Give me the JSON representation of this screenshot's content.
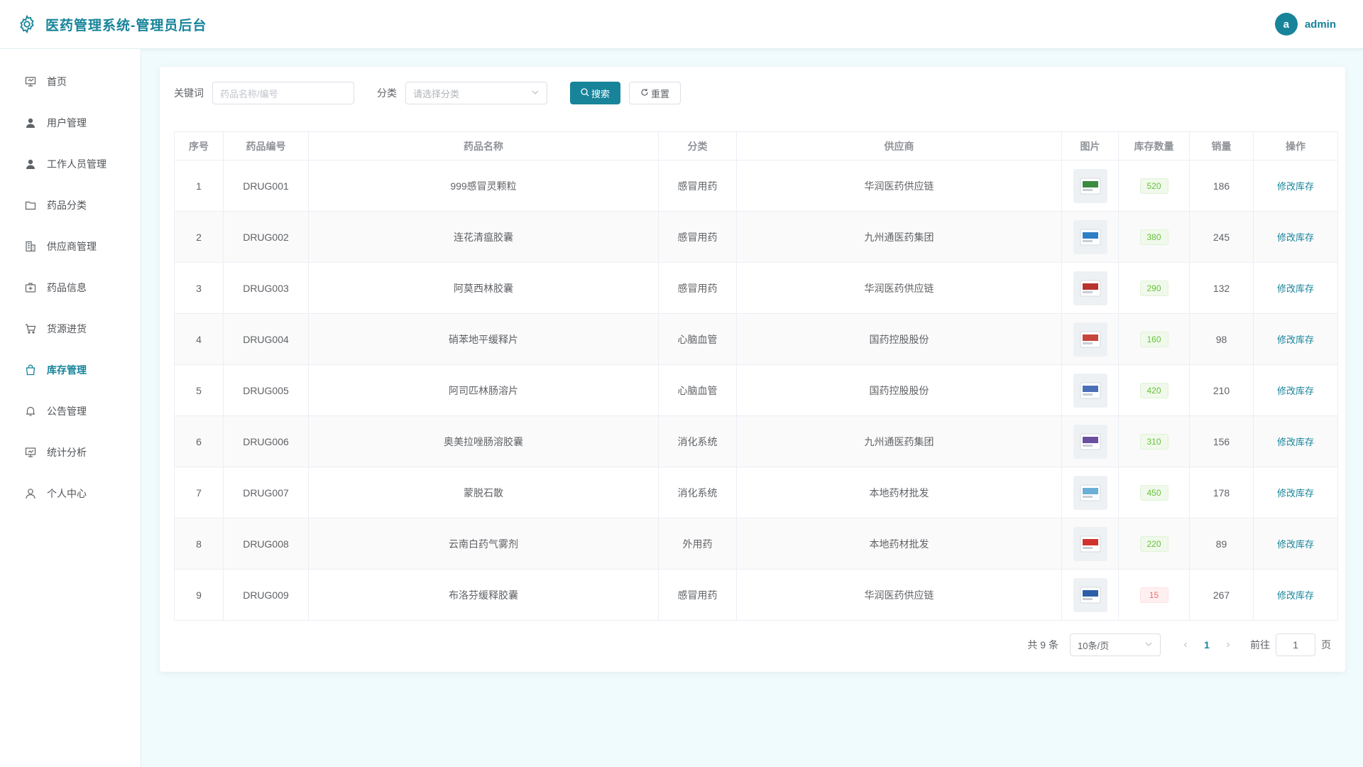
{
  "header": {
    "title": "医药管理系统-管理员后台",
    "avatar_letter": "a",
    "username": "admin"
  },
  "sidebar": {
    "items": [
      {
        "label": "首页",
        "icon": "dashboard-icon"
      },
      {
        "label": "用户管理",
        "icon": "user-filled-icon"
      },
      {
        "label": "工作人员管理",
        "icon": "user-filled-icon"
      },
      {
        "label": "药品分类",
        "icon": "folder-icon"
      },
      {
        "label": "供应商管理",
        "icon": "office-building-icon"
      },
      {
        "label": "药品信息",
        "icon": "first-aid-kit-icon"
      },
      {
        "label": "货源进货",
        "icon": "shopping-cart-icon"
      },
      {
        "label": "库存管理",
        "icon": "shopping-bag-icon",
        "active": true
      },
      {
        "label": "公告管理",
        "icon": "bell-icon"
      },
      {
        "label": "统计分析",
        "icon": "chart-board-icon"
      },
      {
        "label": "个人中心",
        "icon": "user-icon"
      }
    ]
  },
  "filters": {
    "keyword_label": "关键词",
    "keyword_placeholder": "药品名称/编号",
    "category_label": "分类",
    "category_placeholder": "请选择分类",
    "search_button": "搜索",
    "reset_button": "重置"
  },
  "table": {
    "headers": [
      "序号",
      "药品编号",
      "药品名称",
      "分类",
      "供应商",
      "图片",
      "库存数量",
      "销量",
      "操作"
    ],
    "action_label": "修改库存",
    "rows": [
      {
        "idx": "1",
        "code": "DRUG001",
        "name": "999感冒灵颗粒",
        "category": "感冒用药",
        "supplier": "华润医药供应链",
        "stock": "520",
        "sales": "186",
        "low": false,
        "img_color": "#3a8a3f"
      },
      {
        "idx": "2",
        "code": "DRUG002",
        "name": "连花清瘟胶囊",
        "category": "感冒用药",
        "supplier": "九州通医药集团",
        "stock": "380",
        "sales": "245",
        "low": false,
        "img_color": "#2f7fc7"
      },
      {
        "idx": "3",
        "code": "DRUG003",
        "name": "阿莫西林胶囊",
        "category": "感冒用药",
        "supplier": "华润医药供应链",
        "stock": "290",
        "sales": "132",
        "low": false,
        "img_color": "#b8322e"
      },
      {
        "idx": "4",
        "code": "DRUG004",
        "name": "硝苯地平缓释片",
        "category": "心脑血管",
        "supplier": "国药控股股份",
        "stock": "160",
        "sales": "98",
        "low": false,
        "img_color": "#c7453c"
      },
      {
        "idx": "5",
        "code": "DRUG005",
        "name": "阿司匹林肠溶片",
        "category": "心脑血管",
        "supplier": "国药控股股份",
        "stock": "420",
        "sales": "210",
        "low": false,
        "img_color": "#4a70b8"
      },
      {
        "idx": "6",
        "code": "DRUG006",
        "name": "奥美拉唑肠溶胶囊",
        "category": "消化系统",
        "supplier": "九州通医药集团",
        "stock": "310",
        "sales": "156",
        "low": false,
        "img_color": "#6a4fa0"
      },
      {
        "idx": "7",
        "code": "DRUG007",
        "name": "蒙脱石散",
        "category": "消化系统",
        "supplier": "本地药材批发",
        "stock": "450",
        "sales": "178",
        "low": false,
        "img_color": "#6ab0d6"
      },
      {
        "idx": "8",
        "code": "DRUG008",
        "name": "云南白药气雾剂",
        "category": "外用药",
        "supplier": "本地药材批发",
        "stock": "220",
        "sales": "89",
        "low": false,
        "img_color": "#d0332e"
      },
      {
        "idx": "9",
        "code": "DRUG009",
        "name": "布洛芬缓释胶囊",
        "category": "感冒用药",
        "supplier": "华润医药供应链",
        "stock": "15",
        "sales": "267",
        "low": true,
        "img_color": "#2d5fa8"
      }
    ]
  },
  "pagination": {
    "total_text": "共 9 条",
    "page_size": "10条/页",
    "current_page": "1",
    "goto_label": "前往",
    "goto_value": "1",
    "page_suffix": "页"
  },
  "colors": {
    "primary": "#17849a",
    "background": "#effbfc",
    "stock_ok": "#67c23a",
    "stock_low": "#f56c6c"
  }
}
